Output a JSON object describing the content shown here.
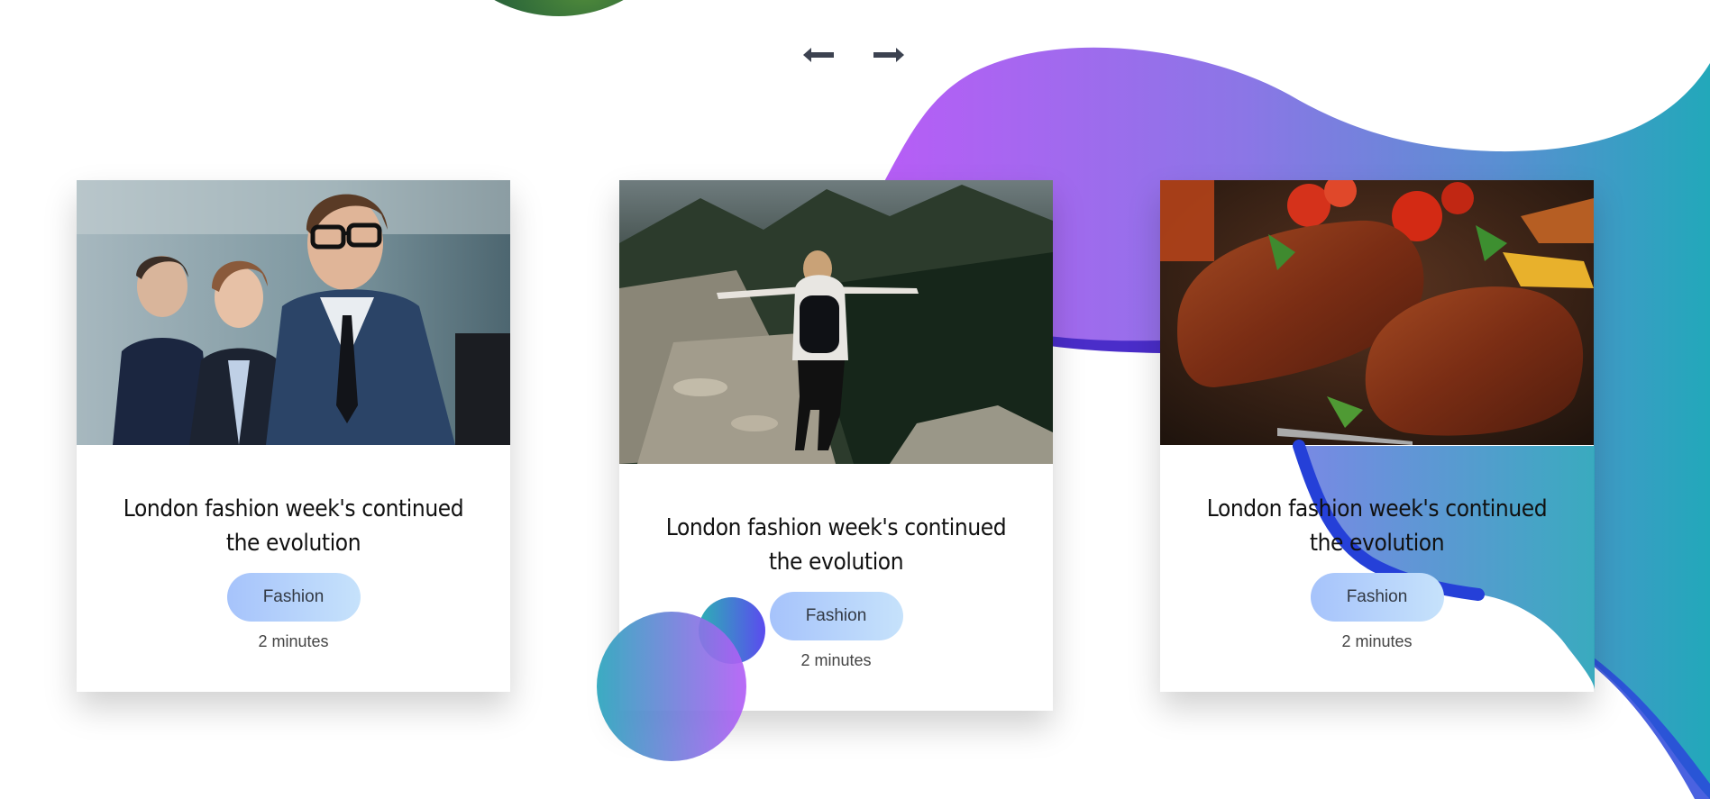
{
  "colors": {
    "blob_start": "#b45cf6",
    "blob_end": "#23a6bc",
    "blob_dark": "#2c3fd8",
    "tag_start": "#a6c3fb",
    "tag_end": "#c6e2fb",
    "arrow": "#3c4250"
  },
  "navigation": {
    "prev_icon": "arrow-left-icon",
    "next_icon": "arrow-right-icon"
  },
  "cards": [
    {
      "image": "business-people-meeting",
      "title_line1": "London fashion week's continued",
      "title_line2": "the evolution",
      "tag": "Fashion",
      "duration": "2 minutes"
    },
    {
      "image": "woman-hiking-mountain-trail",
      "title_line1": "London fashion week's continued",
      "title_line2": "the evolution",
      "tag": "Fashion",
      "duration": "2 minutes"
    },
    {
      "image": "grilled-steaks-with-vegetables",
      "title_line1": "London fashion week's continued",
      "title_line2": "the evolution",
      "tag": "Fashion",
      "duration": "2 minutes"
    }
  ]
}
